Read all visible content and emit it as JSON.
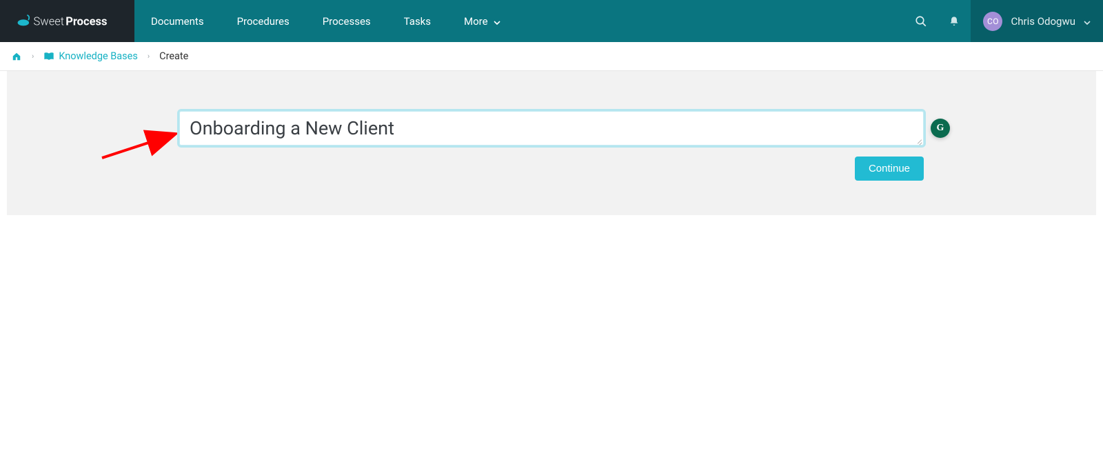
{
  "brand": {
    "name_light": "Sweet",
    "name_bold": "Process"
  },
  "nav": {
    "items": [
      {
        "label": "Documents"
      },
      {
        "label": "Procedures"
      },
      {
        "label": "Processes"
      },
      {
        "label": "Tasks"
      },
      {
        "label": "More",
        "has_dropdown": true
      }
    ]
  },
  "user": {
    "initials": "CO",
    "name": "Chris Odogwu"
  },
  "breadcrumb": {
    "knowledge_bases": "Knowledge Bases",
    "current": "Create"
  },
  "form": {
    "title_value": "Onboarding a New Client",
    "continue_label": "Continue"
  },
  "grammarly": {
    "letter": "G"
  }
}
